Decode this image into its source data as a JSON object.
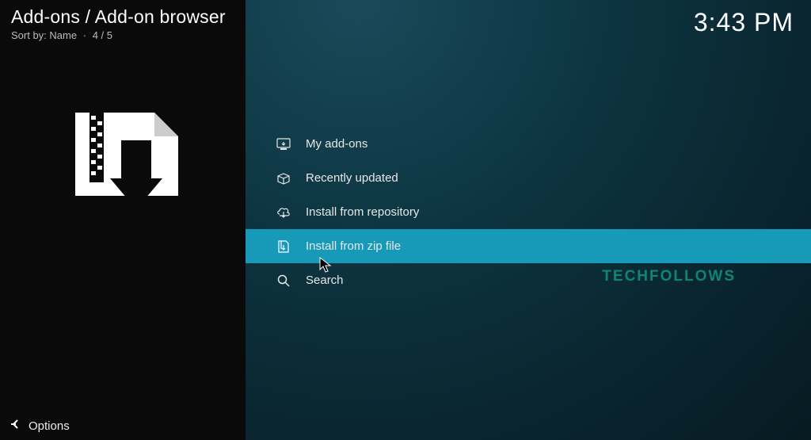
{
  "header": {
    "title": "Add-ons / Add-on browser",
    "sort_label": "Sort by:",
    "sort_value": "Name",
    "position": "4 / 5"
  },
  "clock": "3:43 PM",
  "menu": {
    "items": [
      {
        "label": "My add-ons",
        "icon": "monitor-icon",
        "selected": false
      },
      {
        "label": "Recently updated",
        "icon": "open-box-icon",
        "selected": false
      },
      {
        "label": "Install from repository",
        "icon": "cloud-download-icon",
        "selected": false
      },
      {
        "label": "Install from zip file",
        "icon": "zip-download-icon",
        "selected": true
      },
      {
        "label": "Search",
        "icon": "search-icon",
        "selected": false
      }
    ]
  },
  "footer": {
    "options_label": "Options"
  },
  "watermark": "TECHFOLLOWS"
}
